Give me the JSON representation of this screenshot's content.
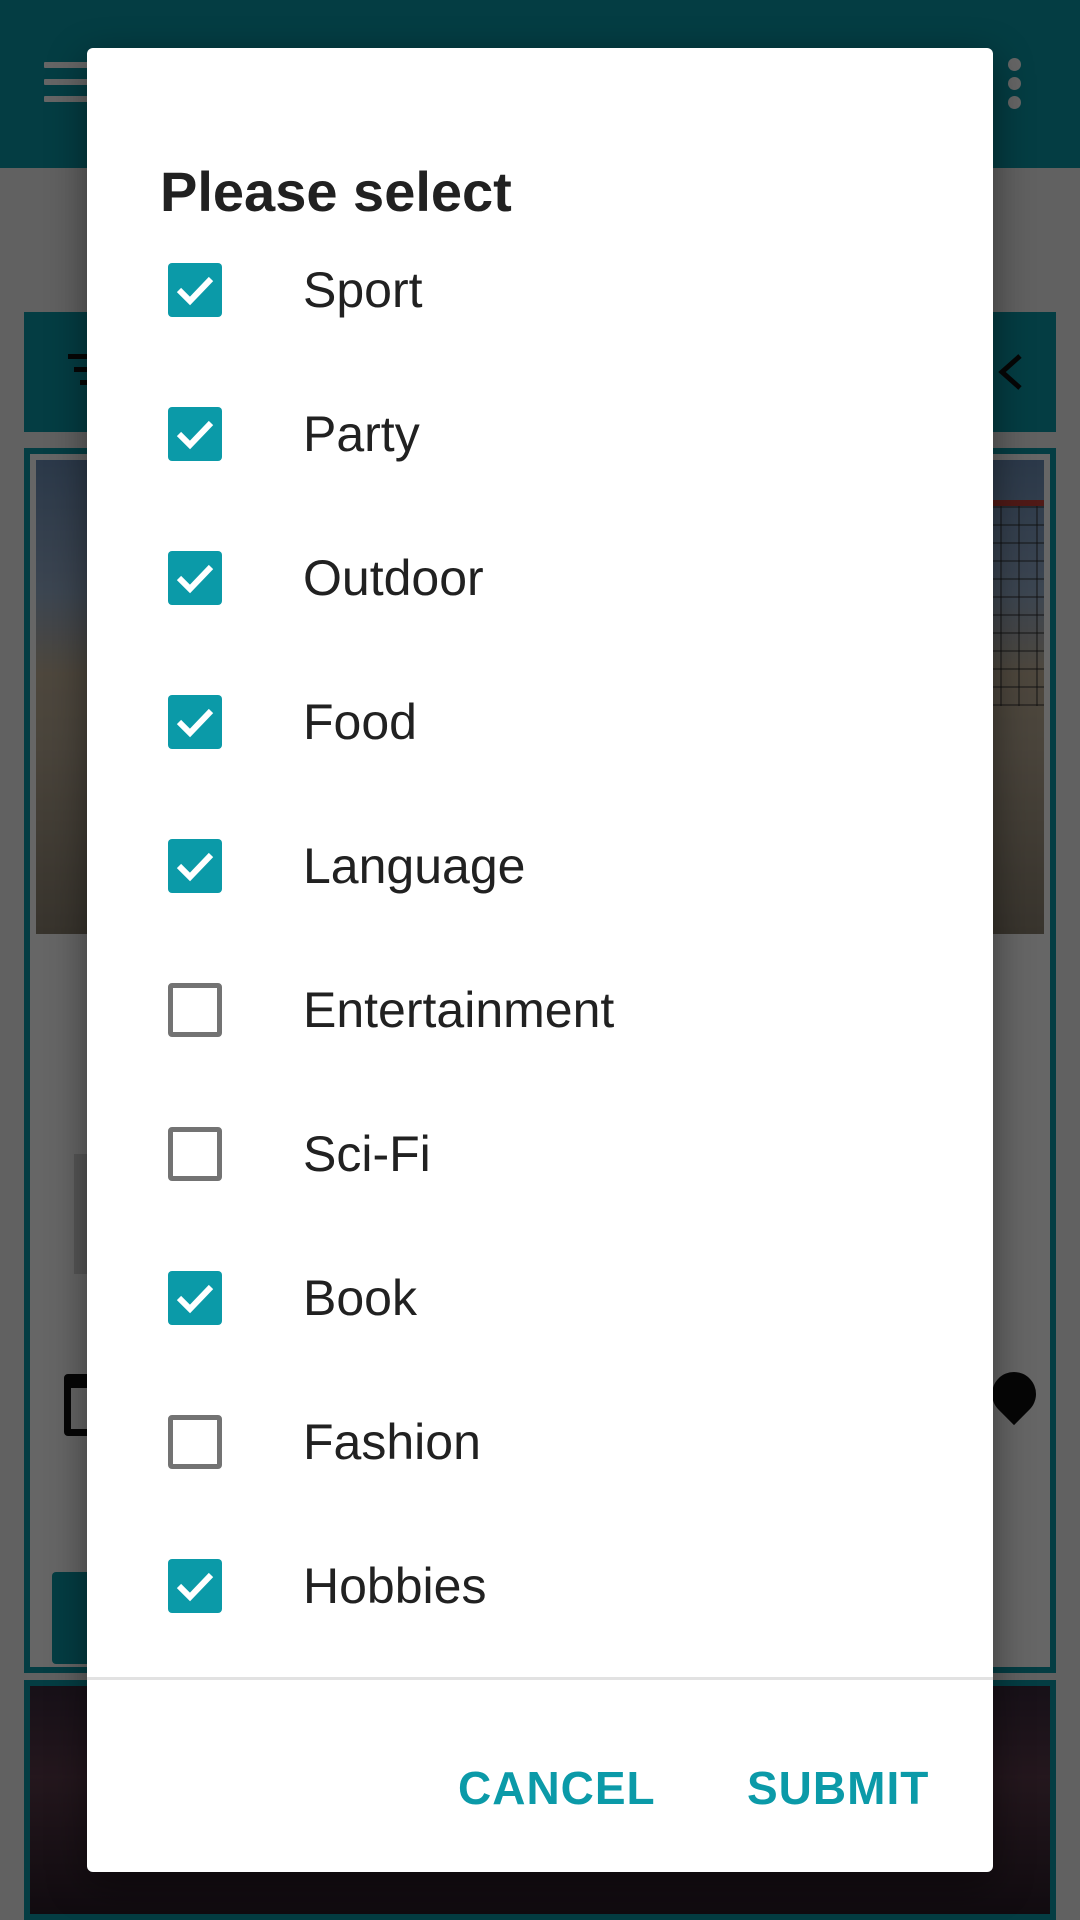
{
  "theme": {
    "accent": "#0b9aa8",
    "checkbox_on_color": "#0b9aa8",
    "checkbox_off_color": "#737373"
  },
  "background_app": {
    "toolbar_icons": [
      "hamburger-menu-icon",
      "more-vert-icon"
    ],
    "filter_bar_icons": [
      "filter-icon",
      "collapse-chevron-icon"
    ],
    "card_icons": [
      "calendar-icon",
      "location-pin-icon"
    ]
  },
  "dialog": {
    "title": "Please select",
    "options": [
      {
        "label": "Sport",
        "checked": true
      },
      {
        "label": "Party",
        "checked": true
      },
      {
        "label": "Outdoor",
        "checked": true
      },
      {
        "label": "Food",
        "checked": true
      },
      {
        "label": "Language",
        "checked": true
      },
      {
        "label": "Entertainment",
        "checked": false
      },
      {
        "label": "Sci-Fi",
        "checked": false
      },
      {
        "label": "Book",
        "checked": true
      },
      {
        "label": "Fashion",
        "checked": false
      },
      {
        "label": "Hobbies",
        "checked": true
      }
    ],
    "cancel_label": "CANCEL",
    "submit_label": "SUBMIT"
  }
}
